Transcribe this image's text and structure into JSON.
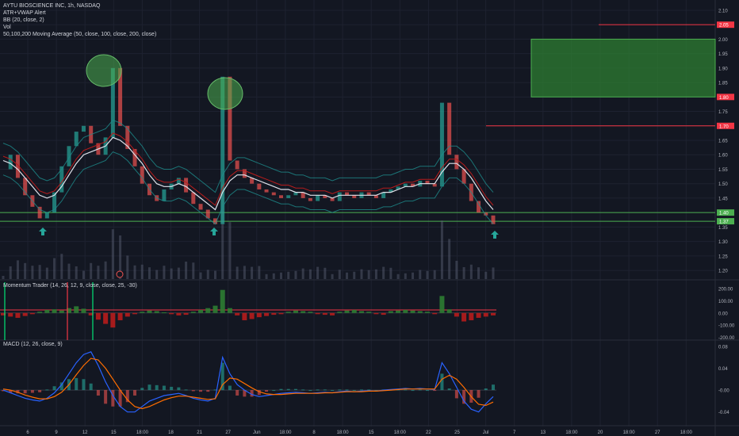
{
  "header": {
    "symbol": "AYTU BIOSCIENCE INC, 1h, NASDAQ",
    "indicators": [
      "ATR+VWAP Alert",
      "BB (20, close, 2)",
      "Vol",
      "50,100,200 Moving Average (50, close, 100, close, 200, close)"
    ]
  },
  "panes": {
    "momentum_label": "Momentum Trader (14, 26, 12, 9, close, close, 25, -30)",
    "macd_label": "MACD (12, 26, close, 9)"
  },
  "colors": {
    "background": "#131722",
    "price_line": "#d1d4dc",
    "bull": "#26a69a",
    "bear": "#ef5350",
    "support": "#4caf50",
    "resistance": "#f23645",
    "target_box": "#2e7d32",
    "ma_white": "#e0e3eb",
    "bb": "#1e8c8c",
    "ma_red": "#b71c1c",
    "grid": "#1e2230",
    "macd": "#2962ff",
    "signal": "#ff6d00"
  },
  "chart_data": [
    {
      "type": "line",
      "title": "AYTU BIOSCIENCE INC, 1h, NASDAQ",
      "xlabel": "",
      "ylabel": "",
      "ylim": [
        1.17,
        2.13
      ],
      "y_ticks": [
        1.2,
        1.25,
        1.3,
        1.35,
        1.4,
        1.45,
        1.5,
        1.55,
        1.6,
        1.65,
        1.7,
        1.75,
        1.8,
        1.85,
        1.9,
        1.95,
        2.0,
        2.05,
        2.1
      ],
      "x_tick_labels": [
        "6",
        "9",
        "12",
        "15",
        "18:00",
        "18",
        "21",
        "27",
        "Jun",
        "18:00",
        "8",
        "18:00",
        "15",
        "18:00",
        "22",
        "25",
        "Jul",
        "7",
        "13",
        "18:00",
        "20",
        "18:00",
        "27",
        "18:00"
      ],
      "series": [
        {
          "name": "",
          "role": "price",
          "values": [
            1.55,
            1.6,
            1.52,
            1.46,
            1.42,
            1.38,
            1.4,
            1.47,
            1.56,
            1.63,
            1.68,
            1.7,
            1.64,
            1.6,
            1.66,
            1.9,
            1.7,
            1.62,
            1.56,
            1.5,
            1.46,
            1.44,
            1.48,
            1.5,
            1.52,
            1.47,
            1.43,
            1.41,
            1.38,
            1.36,
            1.87,
            1.58,
            1.55,
            1.52,
            1.5,
            1.48,
            1.47,
            1.46,
            1.45,
            1.46,
            1.47,
            1.45,
            1.44,
            1.46,
            1.45,
            1.44,
            1.47,
            1.46,
            1.45,
            1.47,
            1.46,
            1.45,
            1.47,
            1.48,
            1.49,
            1.5,
            1.49,
            1.51,
            1.5,
            1.49,
            1.78,
            1.6,
            1.55,
            1.5,
            1.44,
            1.4,
            1.39,
            1.36
          ]
        },
        {
          "name": "",
          "role": "moving-average",
          "values": [
            1.58,
            1.57,
            1.55,
            1.52,
            1.49,
            1.46,
            1.45,
            1.46,
            1.49,
            1.53,
            1.57,
            1.6,
            1.61,
            1.62,
            1.63,
            1.66,
            1.65,
            1.63,
            1.6,
            1.57,
            1.53,
            1.5,
            1.49,
            1.49,
            1.5,
            1.49,
            1.47,
            1.45,
            1.43,
            1.41,
            1.47,
            1.51,
            1.53,
            1.53,
            1.52,
            1.51,
            1.5,
            1.49,
            1.48,
            1.48,
            1.47,
            1.47,
            1.46,
            1.46,
            1.46,
            1.45,
            1.46,
            1.46,
            1.46,
            1.46,
            1.46,
            1.46,
            1.47,
            1.47,
            1.48,
            1.49,
            1.49,
            1.5,
            1.5,
            1.5,
            1.54,
            1.57,
            1.57,
            1.55,
            1.52,
            1.48,
            1.44,
            1.41
          ]
        }
      ],
      "horizontal_lines": [
        {
          "value": 1.37,
          "label": "1.37",
          "color": "#4caf50"
        },
        {
          "value": 1.4,
          "label": "1.40",
          "color": "#4caf50"
        },
        {
          "value": 1.7,
          "label": "1.70",
          "color": "#f23645"
        },
        {
          "value": 2.05,
          "label": "2.05",
          "color": "#f23645"
        }
      ],
      "target_zone": {
        "from": 1.8,
        "to": 2.0,
        "label": "1.80"
      },
      "annotations": [
        "peak-circle",
        "peak-circle",
        "buy-arrow",
        "buy-arrow",
        "buy-arrow",
        "earnings-marker"
      ]
    },
    {
      "type": "bar",
      "title": "Momentum Trader (14, 26, 12, 9, close, close, 25, -30)",
      "ylim": [
        -230,
        260
      ],
      "y_ticks": [
        200,
        100,
        0,
        -100,
        -200
      ],
      "y_tick_labels": [
        "200.00",
        "100.00",
        "0.00",
        "-100.00",
        "-200.00"
      ],
      "values": [
        -20,
        -30,
        -40,
        -25,
        -10,
        10,
        25,
        30,
        20,
        40,
        55,
        35,
        -20,
        -55,
        -90,
        -120,
        -60,
        -30,
        -10,
        10,
        20,
        15,
        5,
        -10,
        -20,
        -15,
        10,
        25,
        40,
        60,
        190,
        40,
        -20,
        -60,
        -50,
        -35,
        -25,
        -15,
        -10,
        10,
        20,
        15,
        10,
        -10,
        -15,
        -20,
        10,
        20,
        25,
        15,
        10,
        -10,
        -15,
        15,
        20,
        25,
        20,
        15,
        10,
        -10,
        140,
        30,
        -30,
        -70,
        -60,
        -40,
        -30,
        -20
      ]
    },
    {
      "type": "line",
      "title": "MACD (12, 26, close, 9)",
      "ylim": [
        -0.055,
        0.09
      ],
      "y_ticks": [
        0.08,
        0.04,
        0.0,
        -0.04
      ],
      "y_tick_labels": [
        "0.08",
        "0.04",
        "-0.00",
        "-0.04"
      ],
      "series": [
        {
          "name": "",
          "role": "macd",
          "values": [
            0.0,
            -0.005,
            -0.01,
            -0.015,
            -0.018,
            -0.02,
            -0.015,
            -0.005,
            0.01,
            0.03,
            0.05,
            0.065,
            0.07,
            0.045,
            0.015,
            -0.01,
            -0.03,
            -0.04,
            -0.04,
            -0.03,
            -0.02,
            -0.015,
            -0.01,
            -0.008,
            -0.006,
            -0.01,
            -0.015,
            -0.018,
            -0.02,
            -0.015,
            0.06,
            0.03,
            0.01,
            0.0,
            -0.008,
            -0.012,
            -0.01,
            -0.008,
            -0.006,
            -0.005,
            -0.004,
            -0.005,
            -0.006,
            -0.005,
            -0.004,
            -0.005,
            -0.003,
            -0.002,
            -0.003,
            -0.002,
            -0.001,
            -0.002,
            0.0,
            0.001,
            0.002,
            0.003,
            0.002,
            0.003,
            0.002,
            0.001,
            0.05,
            0.03,
            0.005,
            -0.02,
            -0.035,
            -0.04,
            -0.025,
            -0.012
          ]
        },
        {
          "name": "",
          "role": "signal",
          "values": [
            0.002,
            0.0,
            -0.004,
            -0.009,
            -0.013,
            -0.016,
            -0.016,
            -0.012,
            -0.004,
            0.01,
            0.028,
            0.045,
            0.058,
            0.055,
            0.04,
            0.02,
            0.0,
            -0.018,
            -0.03,
            -0.034,
            -0.03,
            -0.024,
            -0.018,
            -0.014,
            -0.011,
            -0.011,
            -0.013,
            -0.015,
            -0.017,
            -0.016,
            0.01,
            0.022,
            0.02,
            0.012,
            0.004,
            -0.003,
            -0.007,
            -0.008,
            -0.008,
            -0.007,
            -0.006,
            -0.006,
            -0.006,
            -0.006,
            -0.005,
            -0.005,
            -0.004,
            -0.003,
            -0.003,
            -0.003,
            -0.002,
            -0.002,
            -0.001,
            0.0,
            0.001,
            0.002,
            0.002,
            0.002,
            0.002,
            0.002,
            0.02,
            0.027,
            0.02,
            0.005,
            -0.012,
            -0.026,
            -0.028,
            -0.022
          ]
        }
      ]
    }
  ]
}
